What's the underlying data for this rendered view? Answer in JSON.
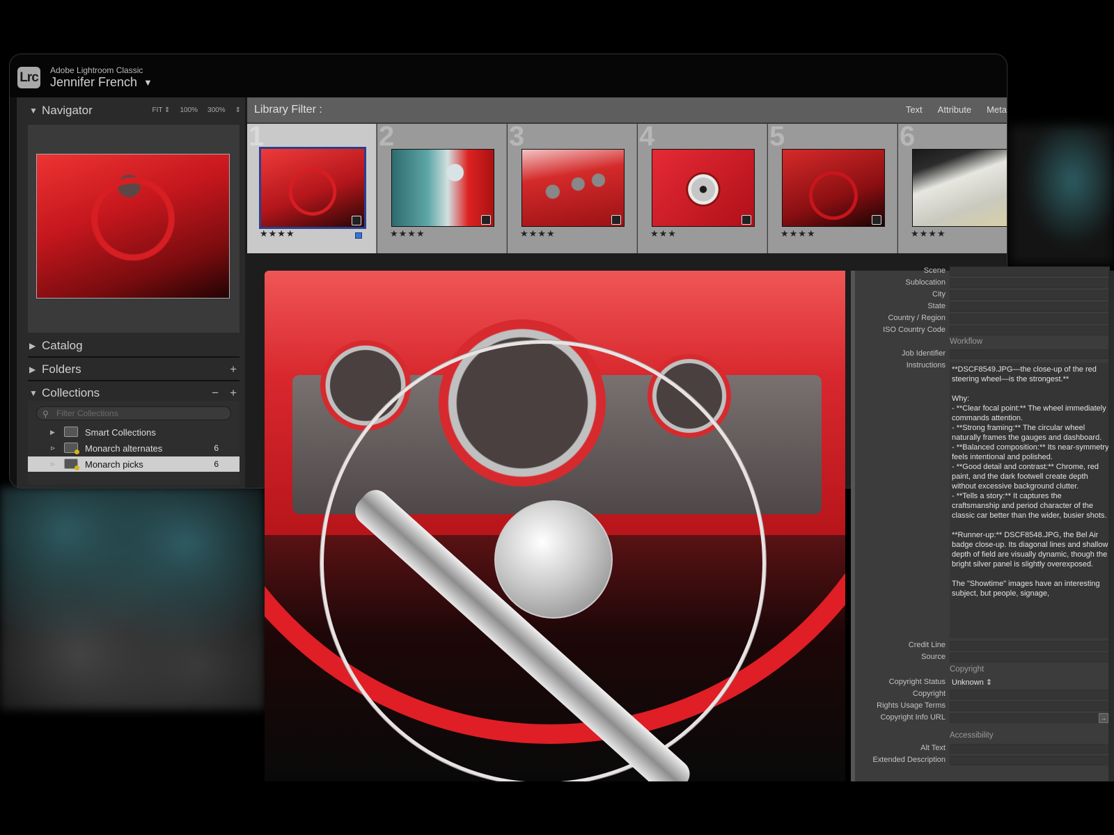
{
  "app": {
    "logo_text": "Lrc",
    "name": "Adobe Lightroom Classic",
    "user": "Jennifer French",
    "user_caret": "▼"
  },
  "navigator": {
    "title": "Navigator",
    "options": [
      "FIT ⇕",
      "100%",
      "300%",
      "⇕"
    ]
  },
  "panels": {
    "catalog": "Catalog",
    "folders": "Folders",
    "collections": "Collections",
    "plus": "+",
    "minus": "−"
  },
  "collections": {
    "filter_placeholder": "Filter Collections",
    "items": [
      {
        "label": "Smart Collections",
        "count": ""
      },
      {
        "label": "Monarch alternates",
        "count": "6"
      },
      {
        "label": "Monarch picks",
        "count": "6"
      }
    ]
  },
  "library_filter": {
    "title": "Library Filter :",
    "tabs": [
      "Text",
      "Attribute",
      "Meta"
    ]
  },
  "filmstrip": [
    {
      "num": "1",
      "stars": "★★★★",
      "selected": true
    },
    {
      "num": "2",
      "stars": "★★★★",
      "selected": false
    },
    {
      "num": "3",
      "stars": "★★★★",
      "selected": false
    },
    {
      "num": "4",
      "stars": "★★★",
      "selected": false
    },
    {
      "num": "5",
      "stars": "★★★★",
      "selected": false
    },
    {
      "num": "6",
      "stars": "★★★★",
      "selected": false
    }
  ],
  "metadata": {
    "scene": "Scene",
    "sublocation": "Sublocation",
    "city": "City",
    "state": "State",
    "country": "Country / Region",
    "iso": "ISO Country Code",
    "workflow_section": "Workflow",
    "job_identifier": "Job Identifier",
    "instructions_label": "Instructions",
    "instructions_text": "**DSCF8549.JPG—the close-up of the red steering wheel—is the strongest.**\n\nWhy:\n- **Clear focal point:** The wheel immediately commands attention.\n- **Strong framing:** The circular wheel naturally frames the gauges and dashboard.\n- **Balanced composition:** Its near-symmetry feels intentional and polished.\n- **Good detail and contrast:** Chrome, red paint, and the dark footwell create depth without excessive background clutter.\n- **Tells a story:** It captures the craftsmanship and period character of the classic car better than the wider, busier shots.\n\n**Runner-up:** DSCF8548.JPG, the Bel Air badge close-up. Its diagonal lines and shallow depth of field are visually dynamic, though the bright silver panel is slightly overexposed.\n\nThe \"Showtime\" images have an interesting subject, but people, signage,",
    "credit_line": "Credit Line",
    "source": "Source",
    "copyright_section": "Copyright",
    "copyright_status_label": "Copyright Status",
    "copyright_status_value": "Unknown ⇕",
    "copyright_label": "Copyright",
    "rights_label": "Rights Usage Terms",
    "copyright_url_label": "Copyright Info URL",
    "url_button": "→",
    "accessibility_section": "Accessibility",
    "alt_text": "Alt Text",
    "extended_description": "Extended Description"
  }
}
